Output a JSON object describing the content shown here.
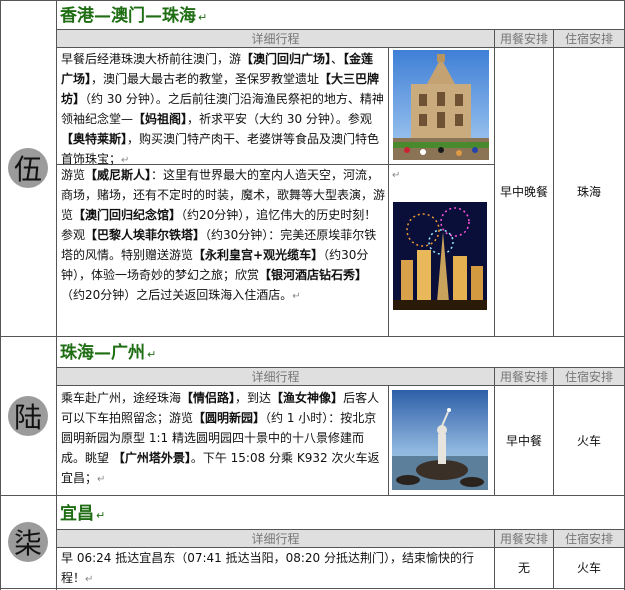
{
  "days": [
    {
      "badge": "伍",
      "title": "香港—澳门—珠海",
      "headers": {
        "details": "详细行程",
        "meals": "用餐安排",
        "stay": "住宿安排"
      },
      "paragraph1_segments": [
        "早餐后经港珠澳大桥前往澳门，游",
        "【澳门回归广场】",
        "、",
        "【金莲广场】",
        "，澳门最大最古老的教堂，圣保罗教堂遗址",
        "【大三巴牌坊】",
        "（约 30 分钟）。之后前往澳门沿海渔民祭祀的地方、精神领袖纪念堂—",
        "【妈祖阁】",
        "，祈求平安（大约 30 分钟）。参观",
        "【奥特莱斯】",
        "，购买澳门特产肉干、老婆饼等食品及澳门特色首饰珠宝；"
      ],
      "paragraph2_segments": [
        "游览",
        "【威尼斯人】",
        "：这里有世界最大的室内人造天空，河流，商场，赌场，还有不定时的时装，魔术，歌舞等大型表演，游览",
        "【澳门回归纪念馆】",
        "（约20分钟），追忆伟大的历史时刻！参观",
        "【巴黎人埃菲尔铁塔】",
        "（约30分钟）：完美还原埃菲尔铁塔的风情。特别赠送游览",
        "【永利皇宫+观光缆车】",
        "（约30分钟），体验一场奇妙的梦幻之旅；欣赏",
        "【银河酒店钻石秀】",
        "（约20分钟）之后过关返回珠海入住酒店。"
      ],
      "meals": "早中晚餐",
      "stay": "珠海"
    },
    {
      "badge": "陆",
      "title": "珠海—广州",
      "headers": {
        "details": "详细行程",
        "meals": "用餐安排",
        "stay": "住宿安排"
      },
      "paragraph_segments": [
        "乘车赴广州，途经珠海",
        "【情侣路】",
        "，到达",
        "【渔女神像】",
        "后客人可以下车拍照留念；游览",
        "【圆明新园】",
        "（约 1 小时）：按北京圆明新园为原型 1:1 精选圆明园四十景中的十八景修建而成。眺望 ",
        "【广州塔外景】",
        "。下午 15:08 分乘 K932 次火车返宜昌；"
      ],
      "meals": "早中餐",
      "stay": "火车"
    },
    {
      "badge": "柒",
      "title": "宜昌",
      "headers": {
        "details": "详细行程",
        "meals": "用餐安排",
        "stay": "住宿安排"
      },
      "paragraph": "早 06:24 抵达宜昌东（07:41 抵达当阳，08:20 分抵达荆门），结束愉快的行程！",
      "meals": "无",
      "stay": "火车"
    }
  ],
  "colors": {
    "title": "#1f6e14",
    "header_bg": "#dfdfdf",
    "badge": "#9b9b9b"
  }
}
